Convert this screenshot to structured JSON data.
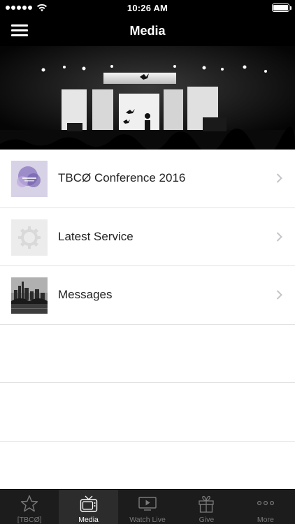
{
  "status_bar": {
    "time": "10:26 AM"
  },
  "nav": {
    "title": "Media"
  },
  "media_items": [
    {
      "label": "TBCØ Conference 2016",
      "thumb": "conference-art"
    },
    {
      "label": "Latest Service",
      "thumb": "gear-placeholder"
    },
    {
      "label": "Messages",
      "thumb": "city-bridge-photo"
    }
  ],
  "tabs": [
    {
      "label": "[TBCØ]",
      "icon": "star-icon",
      "active": false
    },
    {
      "label": "Media",
      "icon": "tv-icon",
      "active": true
    },
    {
      "label": "Watch Live",
      "icon": "play-screen-icon",
      "active": false
    },
    {
      "label": "Give",
      "icon": "gift-icon",
      "active": false
    },
    {
      "label": "More",
      "icon": "more-dots-icon",
      "active": false
    }
  ],
  "colors": {
    "bar_background": "#000000",
    "tab_background": "#1c1c1c",
    "tab_active_background": "#2c2c2c",
    "tab_inactive": "#7a7a7a",
    "tab_active": "#ffffff",
    "separator": "#e2e2e2",
    "row_text": "#222222"
  }
}
